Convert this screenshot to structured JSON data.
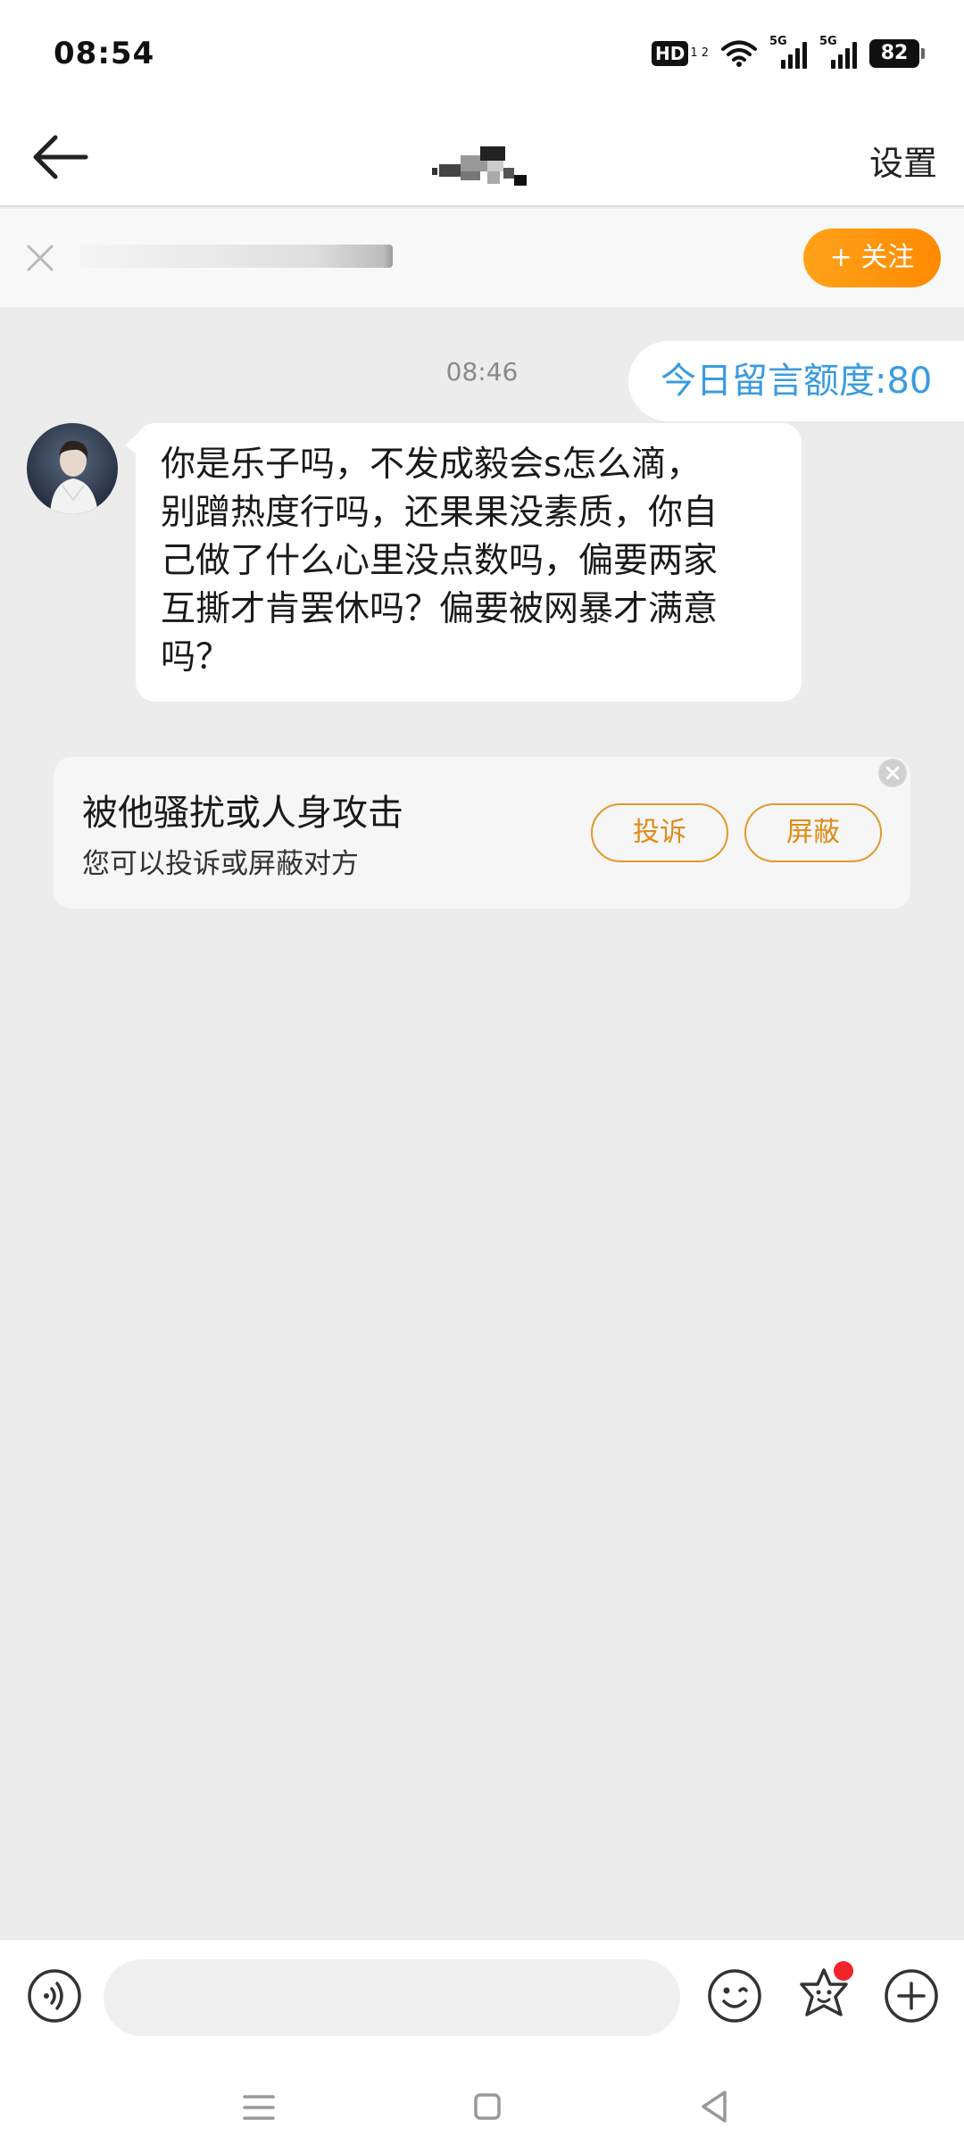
{
  "status_bar": {
    "time": "08:54",
    "hd_label": "HD",
    "hd_sub": "1 2",
    "signal1_label": "5G",
    "signal2_label": "5G",
    "battery": "82"
  },
  "nav": {
    "settings_label": "设置"
  },
  "banner": {
    "follow_label": "+ 关注"
  },
  "chat": {
    "timestamp": "08:46",
    "quota_label": "今日留言额度:80",
    "message_lines": [
      "你是乐子吗，不发成毅会s怎么滴，",
      "别蹭热度行吗，还果果没素质，你自",
      "己做了什么心里没点数吗，偏要两家",
      "互撕才肯罢休吗？偏要被网暴才满意",
      "吗？"
    ]
  },
  "harass_card": {
    "title": "被他骚扰或人身攻击",
    "subtitle": "您可以投诉或屏蔽对方",
    "report_label": "投诉",
    "block_label": "屏蔽"
  },
  "input_bar": {
    "placeholder": "",
    "value": ""
  },
  "colors": {
    "accent_orange": "#ff9a12",
    "quota_blue": "#3a9be0",
    "badge_red": "#f2242b"
  },
  "icons": {
    "back": "arrow-left-icon",
    "banner_close": "close-icon",
    "voice": "voice-icon",
    "emoji": "emoji-icon",
    "sticker": "sticker-icon",
    "plus": "plus-icon"
  }
}
